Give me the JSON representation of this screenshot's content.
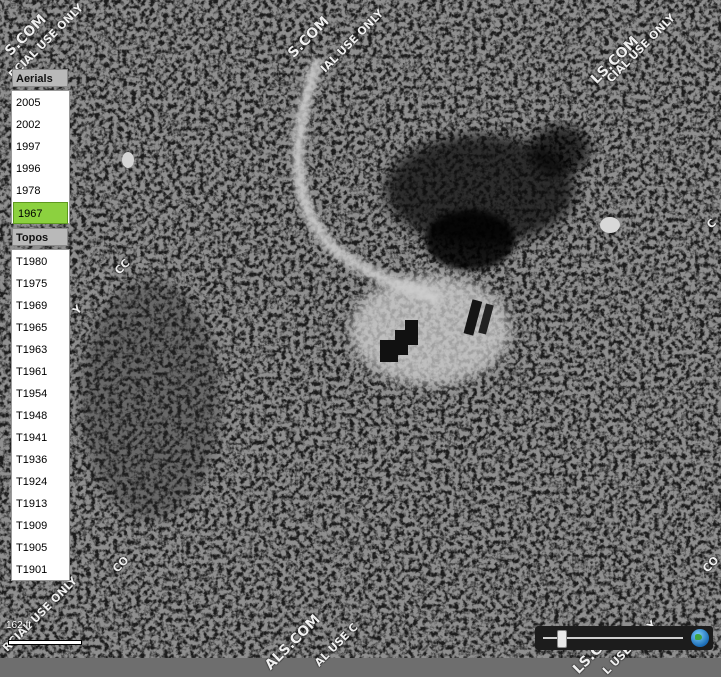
{
  "aerials": {
    "header": "Aerials",
    "years": [
      "2005",
      "2002",
      "1997",
      "1996",
      "1978",
      "1967"
    ],
    "selected": "1967"
  },
  "topos": {
    "header": "Topos",
    "years": [
      "T1980",
      "T1975",
      "T1969",
      "T1965",
      "T1963",
      "T1961",
      "T1954",
      "T1948",
      "T1941",
      "T1936",
      "T1924",
      "T1913",
      "T1909",
      "T1905",
      "T1901"
    ]
  },
  "scale": {
    "label": "162 ft"
  },
  "watermarks": [
    "S.COM",
    "RCIAL USE ONLY",
    "S.COM",
    "IAL USE ONLY",
    "LS.COM",
    "CIAL USE ONLY",
    "CC",
    "CO",
    "Y",
    "ALS.COM",
    "RCIAL USE ONLY",
    "AL USE C",
    "LS.COM",
    "L USE ONLY",
    "CO",
    "C"
  ],
  "colors": {
    "selected_year": "#8cd13f"
  }
}
